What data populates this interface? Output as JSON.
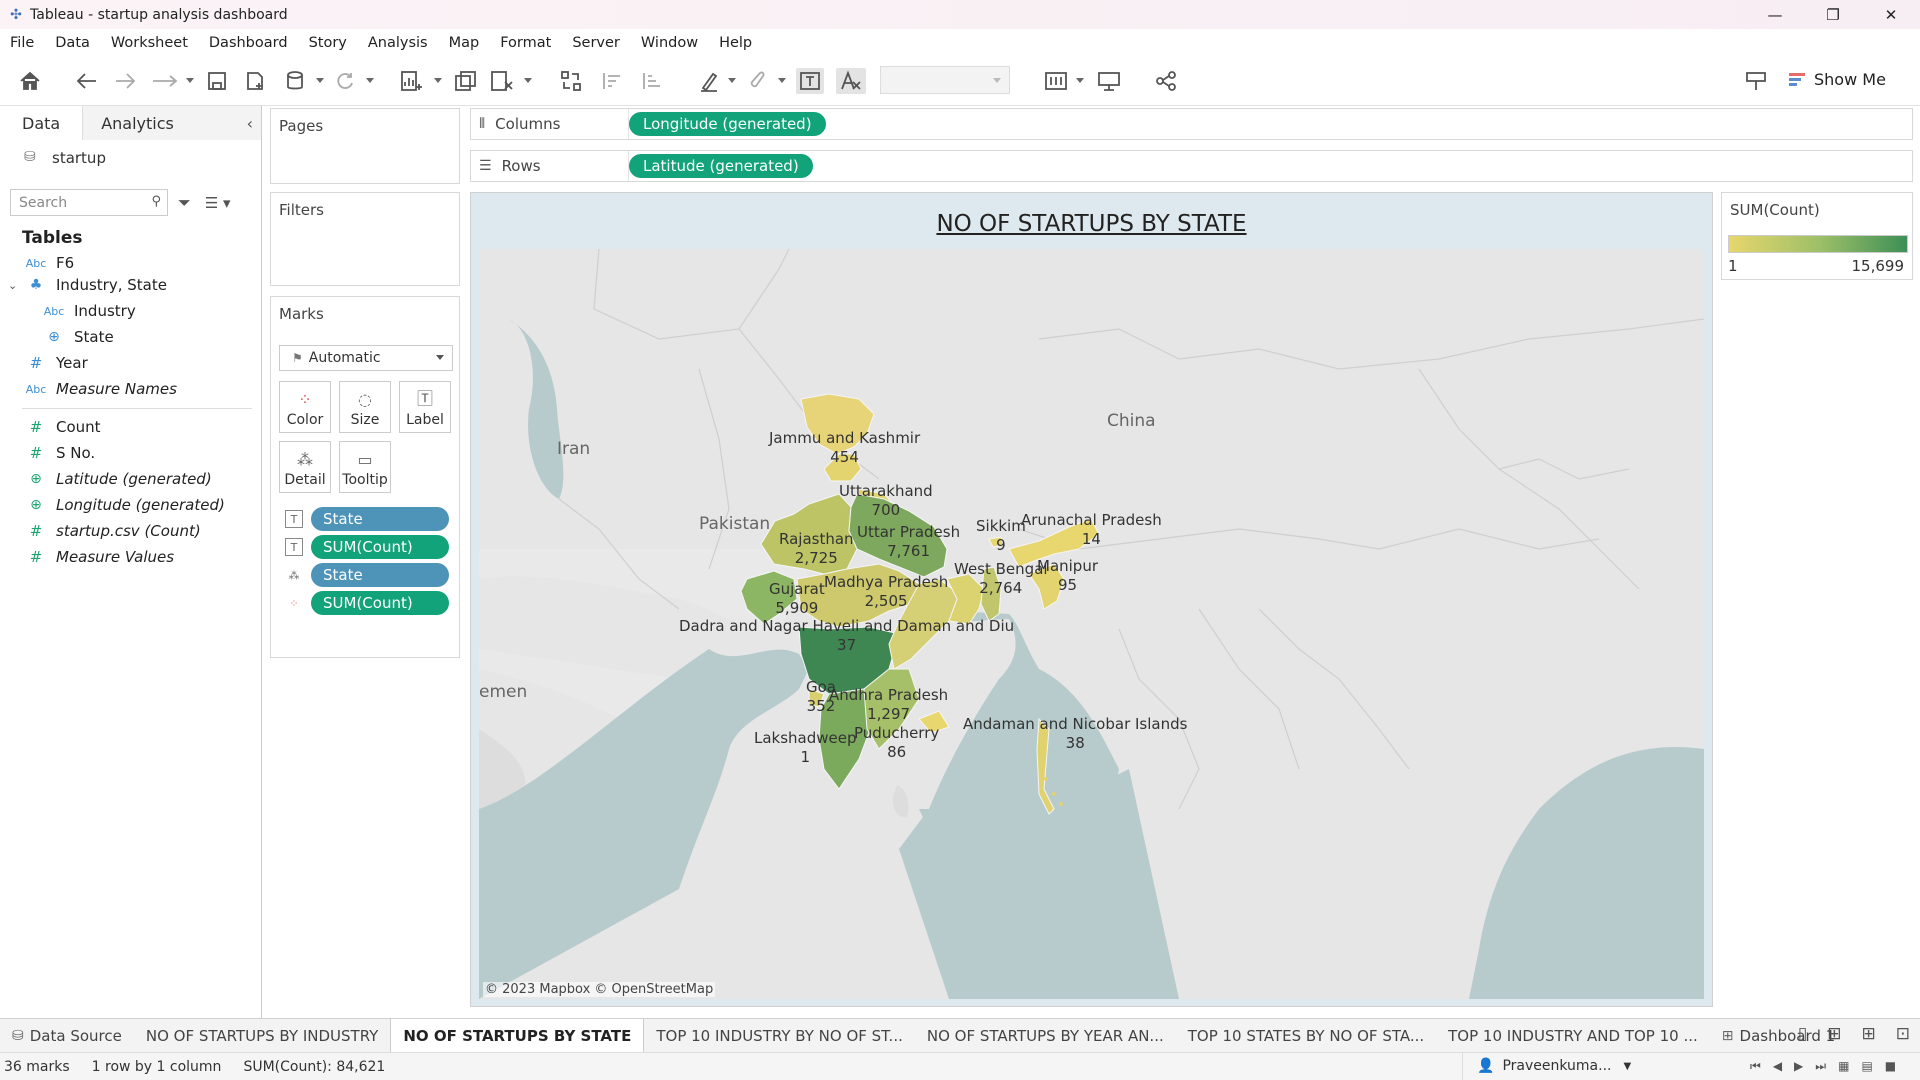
{
  "window": {
    "title": "Tableau - startup analysis dashboard"
  },
  "menu": [
    "File",
    "Data",
    "Worksheet",
    "Dashboard",
    "Story",
    "Analysis",
    "Map",
    "Format",
    "Server",
    "Window",
    "Help"
  ],
  "toolbar": {
    "show_me": "Show Me"
  },
  "data_pane": {
    "tabs": {
      "data": "Data",
      "analytics": "Analytics"
    },
    "datasource": "startup",
    "search_placeholder": "Search",
    "tables_heading": "Tables",
    "fields": [
      {
        "icon": "Abc",
        "name": "F6",
        "italic": false
      },
      {
        "icon": "hier",
        "name": "Industry, State",
        "italic": false
      },
      {
        "icon": "Abc",
        "name": "Industry",
        "italic": false
      },
      {
        "icon": "geo",
        "name": "State",
        "italic": false
      },
      {
        "icon": "#",
        "name": "Year",
        "italic": false
      },
      {
        "icon": "Abc",
        "name": "Measure Names",
        "italic": true
      },
      {
        "icon": "#",
        "name": "Count",
        "italic": false
      },
      {
        "icon": "#",
        "name": "S No.",
        "italic": false
      },
      {
        "icon": "geo",
        "name": "Latitude (generated)",
        "italic": true
      },
      {
        "icon": "geo",
        "name": "Longitude (generated)",
        "italic": true
      },
      {
        "icon": "#",
        "name": "startup.csv (Count)",
        "italic": true
      },
      {
        "icon": "#",
        "name": "Measure Values",
        "italic": true
      }
    ]
  },
  "cards": {
    "pages": "Pages",
    "filters": "Filters",
    "marks": "Marks",
    "mark_type": "Automatic",
    "mark_buttons": {
      "color": "Color",
      "size": "Size",
      "label": "Label",
      "detail": "Detail",
      "tooltip": "Tooltip"
    },
    "mark_pills": [
      {
        "kind": "label",
        "text": "State",
        "type": "dim"
      },
      {
        "kind": "label",
        "text": "SUM(Count)",
        "type": "meas"
      },
      {
        "kind": "detail",
        "text": "State",
        "type": "dim"
      },
      {
        "kind": "color",
        "text": "SUM(Count)",
        "type": "meas"
      }
    ]
  },
  "shelves": {
    "columns_label": "Columns",
    "columns_pill": "Longitude (generated)",
    "rows_label": "Rows",
    "rows_pill": "Latitude (generated)"
  },
  "view": {
    "title": "NO OF STARTUPS BY STATE",
    "attribution": "© 2023 Mapbox © OpenStreetMap",
    "countries": [
      "China",
      "Iran",
      "Pakistan",
      "emen"
    ],
    "labels": [
      {
        "state": "Jammu and Kashmir",
        "value": "454"
      },
      {
        "state": "Uttarakhand",
        "value": "700"
      },
      {
        "state": "Rajasthan",
        "value": "2,725"
      },
      {
        "state": "Uttar Pradesh",
        "value": "7,761"
      },
      {
        "state": "Sikkim",
        "value": "9"
      },
      {
        "state": "Arunachal Pradesh",
        "value": "14"
      },
      {
        "state": "West Bengal",
        "value": "2,764"
      },
      {
        "state": "Manipur",
        "value": "95"
      },
      {
        "state": "Gujarat",
        "value": "5,909"
      },
      {
        "state": "Madhya Pradesh",
        "value": "2,505"
      },
      {
        "state": "Dadra and Nagar Haveli and Daman and Diu",
        "value": "37"
      },
      {
        "state": "Goa",
        "value": "352"
      },
      {
        "state": "Andhra Pradesh",
        "value": "1,297"
      },
      {
        "state": "Lakshadweep",
        "value": "1"
      },
      {
        "state": "Puducherry",
        "value": "86"
      },
      {
        "state": "Andaman and Nicobar Islands",
        "value": "38"
      }
    ]
  },
  "legend": {
    "title": "SUM(Count)",
    "min": "1",
    "max": "15,699",
    "colors": [
      "#e7d66d",
      "#9fc068",
      "#3e8f57"
    ]
  },
  "sheet_tabs": [
    {
      "label": "Data Source",
      "active": false
    },
    {
      "label": "NO OF STARTUPS BY INDUSTRY",
      "active": false
    },
    {
      "label": "NO OF STARTUPS BY STATE",
      "active": true
    },
    {
      "label": "TOP 10 INDUSTRY BY NO OF ST...",
      "active": false
    },
    {
      "label": "NO OF STARTUPS BY YEAR AN...",
      "active": false
    },
    {
      "label": "TOP 10 STATES BY NO OF STA...",
      "active": false
    },
    {
      "label": "TOP 10 INDUSTRY AND TOP 10 ...",
      "active": false
    },
    {
      "label": "Dashboard 1",
      "active": false
    }
  ],
  "status": {
    "marks": "36 marks",
    "dims": "1 row by 1 column",
    "sum": "SUM(Count): 84,621",
    "user": "Praveenkuma..."
  }
}
